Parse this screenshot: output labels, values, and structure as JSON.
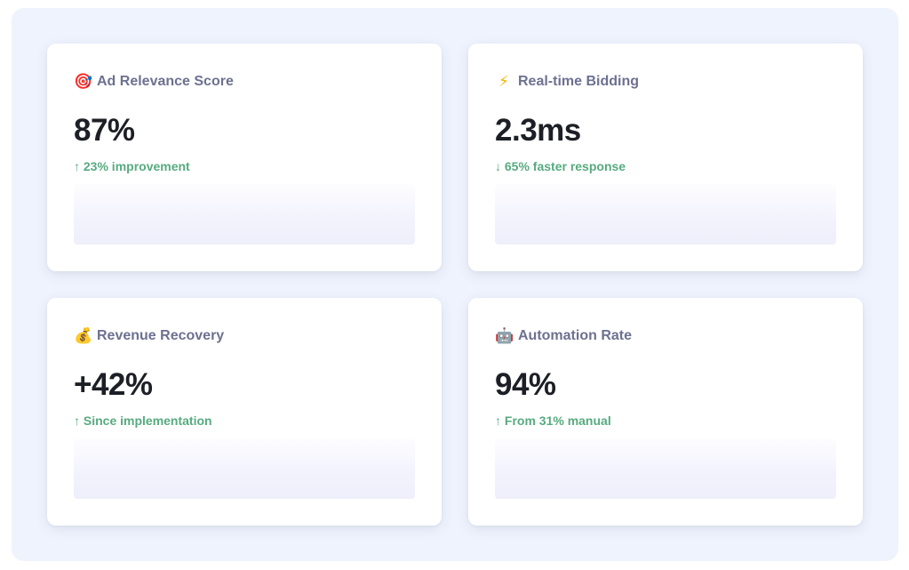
{
  "cards": [
    {
      "icon": "target-icon",
      "icon_glyph": "🎯",
      "title": "Ad Relevance Score",
      "value": "87%",
      "delta": "↑ 23% improvement"
    },
    {
      "icon": "lightning-icon",
      "icon_glyph": "⚡",
      "title": "Real-time Bidding",
      "value": "2.3ms",
      "delta": "↓ 65% faster response"
    },
    {
      "icon": "money-bag-icon",
      "icon_glyph": "💰",
      "title": "Revenue Recovery",
      "value": "+42%",
      "delta": "↑ Since implementation"
    },
    {
      "icon": "robot-icon",
      "icon_glyph": "🤖",
      "title": "Automation Rate",
      "value": "94%",
      "delta": "↑ From 31% manual"
    }
  ],
  "colors": {
    "background": "#eff3fd",
    "card": "#ffffff",
    "title": "#6d7190",
    "value": "#1d1f26",
    "positive": "#57ab7f"
  }
}
